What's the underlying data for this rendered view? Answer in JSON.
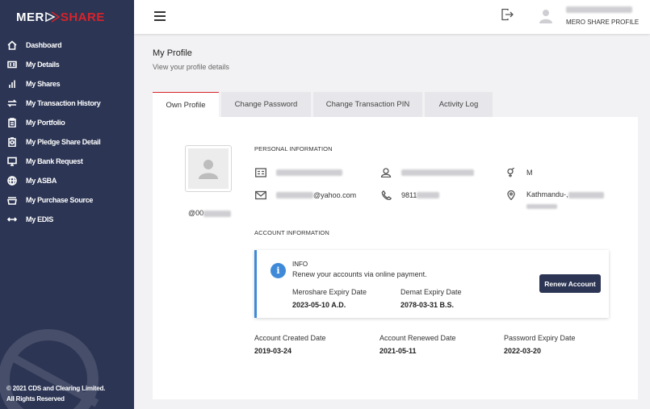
{
  "brand": {
    "part1": "MER",
    "part2": "SHARE"
  },
  "sidebar": {
    "items": [
      {
        "label": "Dashboard",
        "icon": "home-icon"
      },
      {
        "label": "My Details",
        "icon": "id-card-icon"
      },
      {
        "label": "My Shares",
        "icon": "bar-chart-icon"
      },
      {
        "label": "My Transaction History",
        "icon": "swap-icon"
      },
      {
        "label": "My Portfolio",
        "icon": "clipboard-icon"
      },
      {
        "label": "My Pledge Share Detail",
        "icon": "pledge-icon"
      },
      {
        "label": "My Bank Request",
        "icon": "monitor-icon"
      },
      {
        "label": "My ASBA",
        "icon": "globe-icon"
      },
      {
        "label": "My Purchase Source",
        "icon": "inbox-icon"
      },
      {
        "label": "My EDIS",
        "icon": "arrows-icon"
      }
    ],
    "footer_line1": "© 2021 CDS and Clearing Limited.",
    "footer_line2": "All Rights Reserved"
  },
  "topbar": {
    "profile_label": "MERO SHARE PROFILE"
  },
  "page": {
    "title": "My Profile",
    "subtitle": "View your profile details"
  },
  "tabs": [
    "Own Profile",
    "Change Password",
    "Change Transaction PIN",
    "Activity Log"
  ],
  "profile": {
    "userid_prefix": "@00",
    "personal_title": "PERSONAL INFORMATION",
    "gender": "M",
    "email_suffix": "@yahoo.com",
    "phone_prefix": "9811",
    "address": "Kathmandu-,",
    "account_title": "ACCOUNT INFORMATION"
  },
  "infobox": {
    "title": "INFO",
    "message": "Renew your accounts via online payment.",
    "meroshare_label": "Meroshare Expiry Date",
    "meroshare_value": "2023-05-10 A.D.",
    "demat_label": "Demat Expiry Date",
    "demat_value": "2078-03-31 B.S.",
    "button": "Renew Account"
  },
  "dates": {
    "created_label": "Account Created Date",
    "created_value": "2019-03-24",
    "renewed_label": "Account Renewed Date",
    "renewed_value": "2021-05-11",
    "password_label": "Password Expiry Date",
    "password_value": "2022-03-20"
  },
  "colors": {
    "sidebar": "#2c3554",
    "accent_red": "#d8232a",
    "info_blue": "#3f8ad8"
  }
}
